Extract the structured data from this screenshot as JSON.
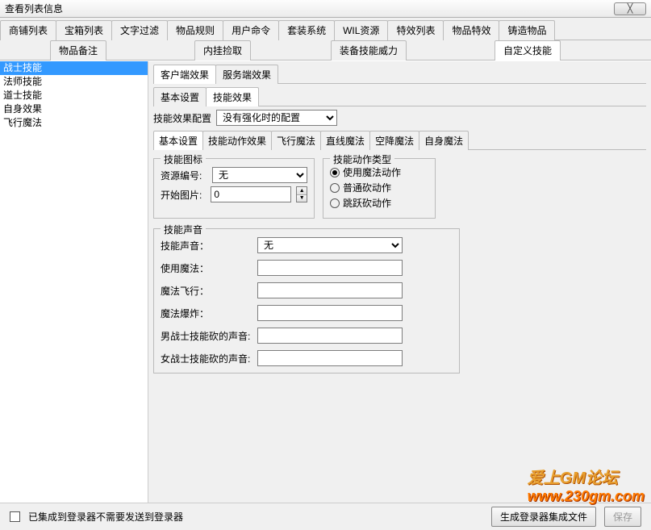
{
  "title": "查看列表信息",
  "close_glyph": "╳",
  "top_tabs_r1": [
    "商铺列表",
    "宝箱列表",
    "文字过滤",
    "物品规则",
    "用户命令",
    "套装系统",
    "WIL资源",
    "特效列表",
    "物品特效",
    "铸造物品"
  ],
  "top_tabs_r2": [
    "物品备注",
    "内挂捡取",
    "装备技能威力",
    "自定义技能"
  ],
  "top_active": "自定义技能",
  "sidebar_items": [
    "战士技能",
    "法师技能",
    "道士技能",
    "自身效果",
    "飞行魔法"
  ],
  "sidebar_selected_index": 0,
  "panel_tabs": [
    "客户端效果",
    "服务端效果"
  ],
  "panel_active": "客户端效果",
  "inner_tabs": [
    "基本设置",
    "技能效果"
  ],
  "inner_active": "技能效果",
  "config_label": "技能效果配置",
  "config_dropdown": "没有强化时的配置",
  "detail_tabs": [
    "基本设置",
    "技能动作效果",
    "飞行魔法",
    "直线魔法",
    "空降魔法",
    "自身魔法"
  ],
  "detail_active": "基本设置",
  "icon_group": {
    "legend": "技能图标",
    "res_label": "资源编号:",
    "res_value": "无",
    "start_label": "开始图片:",
    "start_value": "0"
  },
  "action_group": {
    "legend": "技能动作类型",
    "options": [
      "使用魔法动作",
      "普通砍动作",
      "跳跃砍动作"
    ],
    "selected": 0
  },
  "sound_group": {
    "legend": "技能声音",
    "rows": [
      {
        "label": "技能声音：",
        "type": "select",
        "value": "无"
      },
      {
        "label": "使用魔法：",
        "type": "text",
        "value": ""
      },
      {
        "label": "魔法飞行：",
        "type": "text",
        "value": ""
      },
      {
        "label": "魔法爆炸：",
        "type": "text",
        "value": ""
      },
      {
        "label": "男战士技能砍的声音:",
        "type": "text",
        "value": ""
      },
      {
        "label": "女战士技能砍的声音:",
        "type": "text",
        "value": ""
      }
    ]
  },
  "footer": {
    "checkbox_label": "已集成到登录器不需要发送到登录器",
    "gen_button": "生成登录器集成文件",
    "save_button": "保存"
  },
  "watermark": {
    "line1": "爱上GM论坛",
    "line2": "www.230gm.com"
  }
}
